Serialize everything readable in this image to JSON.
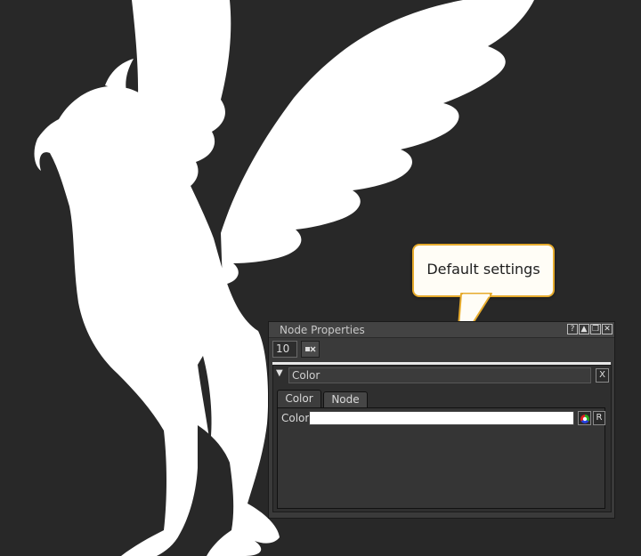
{
  "app": {
    "panel_title": "Node Properties",
    "titlebar_icons": [
      {
        "name": "help-icon",
        "glyph": "?"
      },
      {
        "name": "float-icon",
        "glyph": "▲"
      },
      {
        "name": "restore-icon",
        "glyph": "❐"
      },
      {
        "name": "close-panel-icon",
        "glyph": "✕"
      }
    ],
    "max_panels_value": "10",
    "clear_panels_icon": "clear-icon"
  },
  "callout": {
    "text": "Default settings",
    "border_color": "#e6ab2d",
    "fill_color": "#fffdf6"
  },
  "node": {
    "collapse_icon": "▼",
    "name": "Color",
    "remove_label": "X",
    "tabs": [
      {
        "label": "Color",
        "active": true
      },
      {
        "label": "Node",
        "active": false
      }
    ],
    "knob": {
      "label": "Color",
      "value_color": "#ffffff",
      "reset_label": "R",
      "picker_icon": "color-wheel-icon"
    }
  },
  "viewer": {
    "background_color": "#282828",
    "subject_color": "#ffffff",
    "subject_icon": "griffin-silhouette"
  }
}
